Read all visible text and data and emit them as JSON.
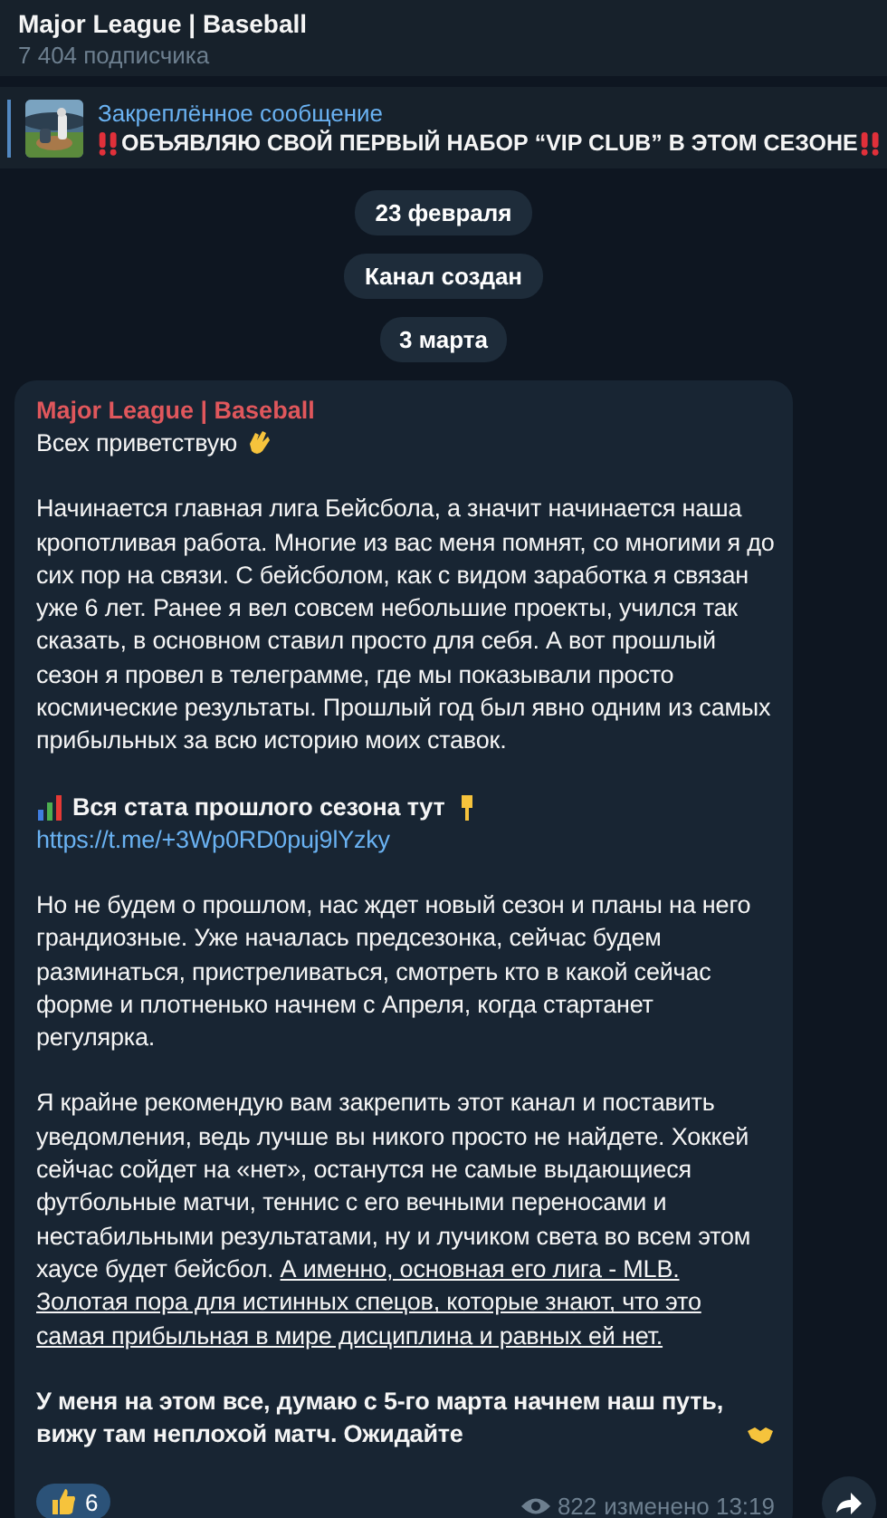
{
  "header": {
    "title": "Major League | Baseball",
    "subtitle": "7 404 подписчика"
  },
  "pinned": {
    "label": "Закреплённое сообщение",
    "text": "ОБЪЯВЛЯЮ СВОЙ ПЕРВЫЙ НАБОР “VIP CLUB” В ЭТОМ СЕЗОНЕ"
  },
  "service_messages": [
    {
      "text": "23 февраля"
    },
    {
      "text": "Канал создан"
    },
    {
      "text": "3 марта"
    }
  ],
  "message": {
    "author": "Major League | Baseball",
    "paragraphs": [
      {
        "kind": "greeting",
        "parts": [
          {
            "text": "Всех приветствую",
            "underline": false
          }
        ]
      },
      {
        "kind": "text",
        "parts": [
          {
            "text": "Начинается главная лига Бейсбола, а значит начинается наша кропотливая работа. Многие из вас меня помнят, со многими я до сих пор на связи. С бейсболом, как с видом заработка я связан уже 6 лет. Ранее я вел совсем небольшие проекты, учился так сказать, в основном ставил просто для себя. А вот прошлый сезон я провел в телеграмме, где мы показывали просто космические результаты. Прошлый год был явно одним из самых прибыльных за всю историю моих ставок.",
            "underline": false
          }
        ]
      },
      {
        "kind": "stats",
        "parts": [
          {
            "text": "Вся стата прошлого сезона тут",
            "underline": false
          }
        ],
        "link": "https://t.me/+3Wp0RD0puj9lYzky"
      },
      {
        "kind": "text",
        "parts": [
          {
            "text": "Но не будем о прошлом, нас ждет новый сезон и планы на него грандиозные. Уже началась предсезонка, сейчас будем разминаться, пристреливаться, смотреть кто в какой сейчас форме и плотненько начнем с Апреля, когда стартанет регулярка.",
            "underline": false
          }
        ]
      },
      {
        "kind": "text",
        "parts": [
          {
            "text": "Я крайне рекомендую вам закрепить этот канал и поставить уведомления, ведь лучше вы никого просто не найдете. Хоккей сейчас сойдет на «нет», останутся не самые выдающиеся футбольные матчи, теннис с его вечными переносами и нестабильными результатами, ну и лучиком света во всем этом хаусе будет бейсбол.",
            "underline": false
          },
          {
            "text": "А именно, основная его лига - MLB.",
            "underline": true
          },
          {
            "text": "Золотая пора для истинных спецов, которые знают, что это самая прибыльная в мире дисциплина и равных ей нет.",
            "underline": true
          }
        ]
      },
      {
        "kind": "closing",
        "parts": [
          {
            "text": "У меня на этом все, думаю с 5-го марта начнем наш путь, вижу там неплохой матч. Ожидайте",
            "underline": false
          }
        ]
      }
    ],
    "reactions": [
      {
        "count": "6"
      }
    ],
    "views": "822",
    "edited_time": "изменено 13:19"
  }
}
